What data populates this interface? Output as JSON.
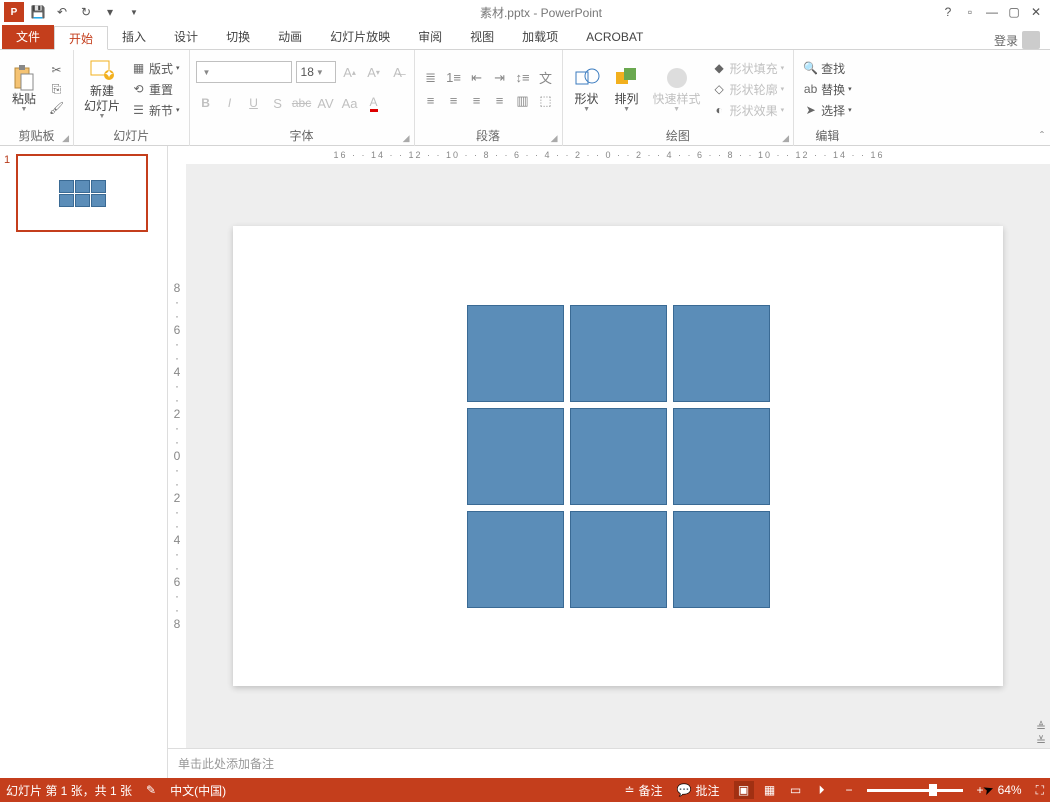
{
  "title": "素材.pptx - PowerPoint",
  "tabs": {
    "file": "文件",
    "home": "开始",
    "insert": "插入",
    "design": "设计",
    "transitions": "切换",
    "animations": "动画",
    "slideshow": "幻灯片放映",
    "review": "审阅",
    "view": "视图",
    "addins": "加载项",
    "acrobat": "ACROBAT"
  },
  "login": "登录",
  "groups": {
    "clipboard": {
      "label": "剪贴板",
      "paste": "粘贴"
    },
    "slides": {
      "label": "幻灯片",
      "newslide": "新建\n幻灯片",
      "layout": "版式",
      "reset": "重置",
      "section": "新节"
    },
    "font": {
      "label": "字体",
      "font_name": "",
      "font_size": "18"
    },
    "paragraph": {
      "label": "段落"
    },
    "drawing": {
      "label": "绘图",
      "shapes": "形状",
      "arrange": "排列",
      "quickstyles": "快速样式",
      "fill": "形状填充",
      "outline": "形状轮廓",
      "effects": "形状效果"
    },
    "editing": {
      "label": "编辑",
      "find": "查找",
      "replace": "替换",
      "select": "选择"
    }
  },
  "ruler_h": "16 · · 14 · · 12 · · 10 · · 8 · · 6 · · 4 · · 2 · · 0 · · 2 · · 4 · · 6 · · 8 · · 10 · · 12 · · 14 · · 16",
  "ruler_v": [
    "8",
    "6",
    "4",
    "2",
    "0",
    "2",
    "4",
    "6",
    "8"
  ],
  "slide_number": "1",
  "notes_placeholder": "单击此处添加备注",
  "status": {
    "pos": "幻灯片 第 1 张，共 1 张",
    "lang": "中文(中国)",
    "notes": "备注",
    "comments": "批注",
    "zoom": "64%"
  }
}
